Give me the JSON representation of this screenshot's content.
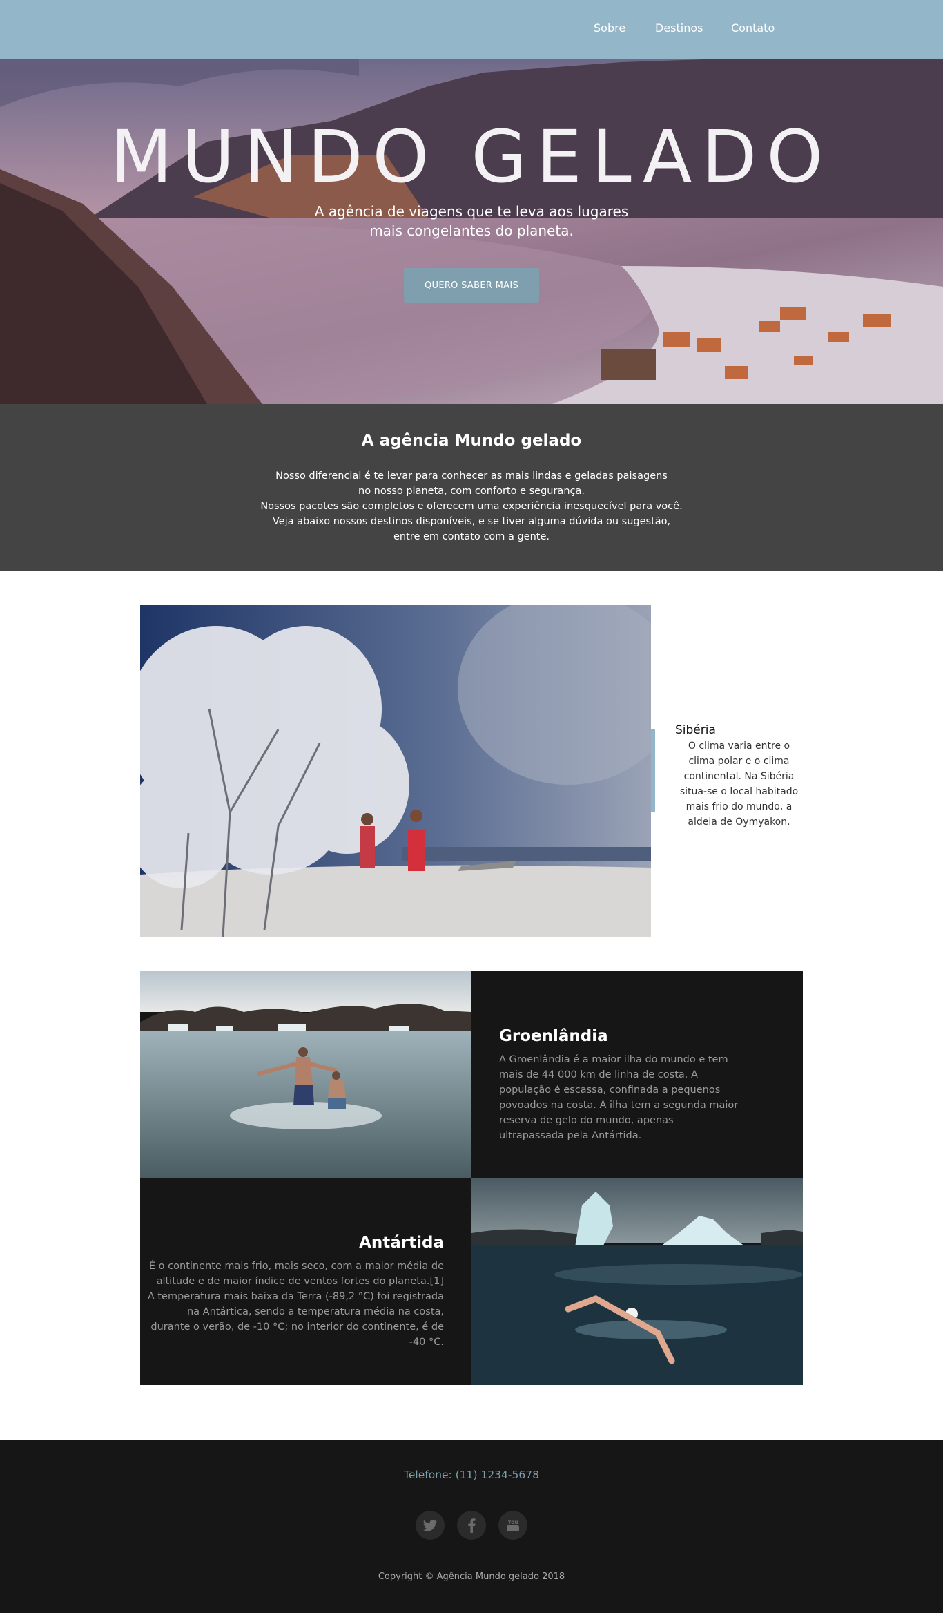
{
  "nav": {
    "items": [
      {
        "label": "Sobre"
      },
      {
        "label": "Destinos"
      },
      {
        "label": "Contato"
      }
    ]
  },
  "hero": {
    "title": "MUNDO GELADO",
    "subtitle_line1": "A agência de viagens que te leva aos lugares",
    "subtitle_line2": "mais congelantes do planeta.",
    "button_label": "QUERO SABER MAIS"
  },
  "agency": {
    "heading": "A agência Mundo gelado",
    "lines": [
      "Nosso diferencial é te levar para conhecer as mais lindas e geladas paisagens",
      "no nosso planeta, com conforto e segurança.",
      "Nossos pacotes são completos e oferecem uma experiência inesquecível para você.",
      "Veja abaixo nossos destinos disponíveis, e se tiver alguma dúvida ou sugestão,",
      "entre em contato com a gente."
    ]
  },
  "destinations": {
    "siberia": {
      "title": "Sibéria",
      "text": "O clima varia entre o clima polar e o clima continental. Na Sibéria situa-se o local habitado mais frio do mundo, a aldeia de Oymyakon."
    },
    "greenland": {
      "title": "Groenlândia",
      "text": "A Groenlândia é a maior ilha do mundo e tem mais de 44 000 km de linha de costa. A população é escassa, confinada a pequenos povoados na costa. A ilha tem a segunda maior reserva de gelo do mundo, apenas ultrapassada pela Antártida."
    },
    "antarctica": {
      "title": "Antártida",
      "text": "É o continente mais frio, mais seco, com a maior média de altitude e de maior índice de ventos fortes do planeta.[1] A temperatura mais baixa da Terra (-89,2 °C) foi registrada na Antártica, sendo a temperatura média na costa, durante o verão, de -10 °C; no interior do continente, é de -40 °C."
    }
  },
  "footer": {
    "phone": "Telefone: (11) 1234-5678",
    "social": [
      {
        "icon": "twitter-icon"
      },
      {
        "icon": "facebook-icon"
      },
      {
        "icon": "youtube-icon"
      }
    ],
    "youtube_glyph": "You",
    "copyright": "Copyright © Agência Mundo gelado 2018"
  },
  "colors": {
    "nav_bg": "#93b6c9",
    "accent": "#7f9fae",
    "agency_bg": "#444444",
    "dark_bg": "#161616"
  }
}
